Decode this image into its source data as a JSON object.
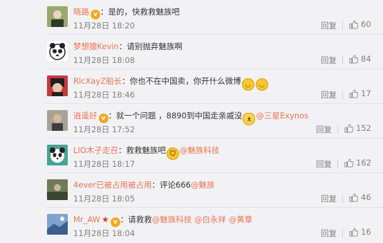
{
  "comments": [
    {
      "username": "晓路",
      "badge": "vip",
      "mid": "",
      "text": "是的，快救救魅族吧",
      "mention1": "",
      "mention2": "",
      "mention3": "",
      "emojis": [],
      "time": "11月28日 18:20",
      "reply": "回复",
      "likes": "60",
      "avatar_bg": "#6b7a4a"
    },
    {
      "username": "梦想猿Kevin",
      "badge": "",
      "mid": "",
      "text": "请别抛弃魅族啊",
      "mention1": "",
      "mention2": "",
      "mention3": "",
      "emojis": [],
      "time": "11月28日 18:08",
      "reply": "回复",
      "likes": "84",
      "avatar_bg": "#222222"
    },
    {
      "username": "RlcXayZ船长",
      "badge": "",
      "mid": "",
      "text": "你也不在中国卖，你开什么微博",
      "mention1": "",
      "mention2": "",
      "mention3": "",
      "emojis": [
        "smile",
        "smile"
      ],
      "time": "11月28日 18:46",
      "reply": "回复",
      "likes": "17",
      "avatar_bg": "#b8333a"
    },
    {
      "username": "逍遥好",
      "badge": "vip",
      "mid": "",
      "text": "就一个问题 ，8890到中国走亲戚没",
      "mention1": "@三星Exynos",
      "mention2": "",
      "mention3": "",
      "emojis": [
        "cat"
      ],
      "time": "11月28日 17:52",
      "reply": "回复",
      "likes": "152",
      "avatar_bg": "#8a8a7a"
    },
    {
      "username": "LIO木子走召",
      "badge": "",
      "mid": "",
      "text": "救救魅族吧",
      "mention1": "@魅族科技",
      "mention2": "",
      "mention3": "",
      "emojis": [
        "laugh"
      ],
      "time": "11月28日 18:17",
      "reply": "回复",
      "likes": "162",
      "avatar_bg": "#3e9a88"
    },
    {
      "username": "4ever已被占用被占用",
      "badge": "",
      "mid": "",
      "text": "评论666",
      "mention1": "@魅族",
      "mention2": "",
      "mention3": "",
      "emojis": [],
      "time": "11月28日 18:05",
      "reply": "回复",
      "likes": "46",
      "avatar_bg": "#4a5a3a"
    },
    {
      "username": "Mr_AW",
      "badge": "vip",
      "mid": "★",
      "text": "请救救",
      "mention1": "@魅族科技",
      "mention2": "@白永祥",
      "mention3": "@黄章",
      "emojis": [],
      "time": "11月28日 18:04",
      "reply": "回复",
      "likes": "16",
      "avatar_bg": "#5a7fb0"
    }
  ]
}
